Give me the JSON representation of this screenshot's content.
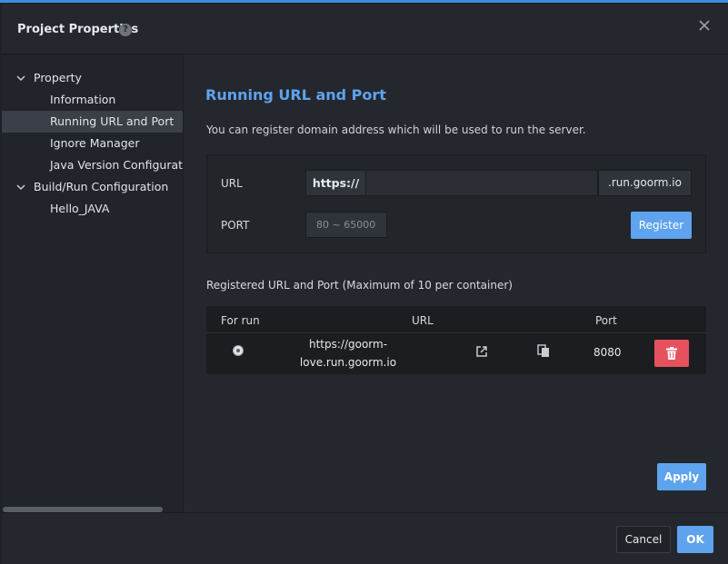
{
  "dialog": {
    "title": "Project Properties",
    "help_icon": "question-circle-icon",
    "close_icon": "close-icon"
  },
  "sidebar": {
    "items": [
      {
        "label": "Property",
        "expandable": true,
        "expanded": true,
        "selected": false
      },
      {
        "label": "Information",
        "selected": false
      },
      {
        "label": "Running URL and Port",
        "selected": true
      },
      {
        "label": "Ignore Manager",
        "selected": false
      },
      {
        "label": "Java Version Configuration",
        "selected": false
      },
      {
        "label": "Build/Run Configuration",
        "expandable": true,
        "expanded": true,
        "selected": false
      },
      {
        "label": "Hello_JAVA",
        "selected": false
      }
    ]
  },
  "main": {
    "title": "Running URL and Port",
    "description": "You can register domain address which will be used to run the server.",
    "form": {
      "url_label": "URL",
      "protocol": "https://",
      "url_value": "",
      "domain_suffix": ".run.goorm.io",
      "port_label": "PORT",
      "port_placeholder": "80 ~ 65000",
      "register_label": "Register"
    },
    "registered": {
      "title": "Registered URL and Port (Maximum of 10 per container)",
      "columns": [
        "For run",
        "URL",
        "Port"
      ],
      "rows": [
        {
          "for_run_selected": true,
          "url_line1": "https://goorm-",
          "url_line2": "love.run.goorm.io",
          "port": "8080"
        }
      ]
    },
    "apply_label": "Apply"
  },
  "footer": {
    "cancel_label": "Cancel",
    "ok_label": "OK"
  },
  "colors": {
    "accent": "#5ea3ee",
    "danger": "#e5525e",
    "background": "#24272d"
  }
}
